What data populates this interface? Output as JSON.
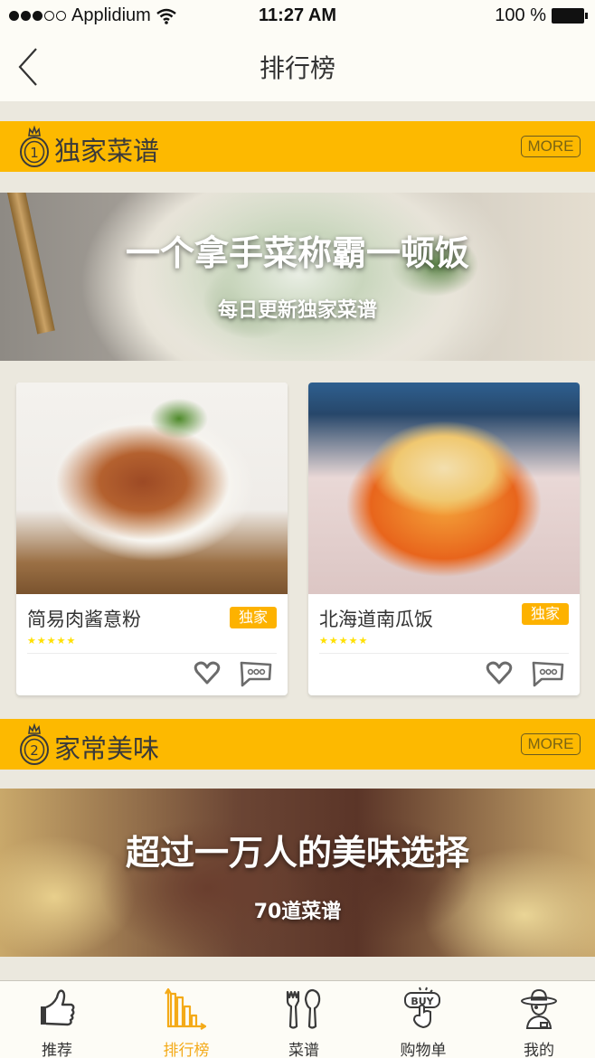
{
  "status_bar": {
    "carrier": "Applidium",
    "signal_bars_filled": 3,
    "signal_bars_total": 5,
    "time": "11:27 AM",
    "battery": "100 %"
  },
  "nav": {
    "title": "排行榜",
    "back_icon": "chevron-left-icon"
  },
  "sections": [
    {
      "rank": "1",
      "title": "独家菜谱",
      "more_label": "MORE",
      "banner": {
        "headline": "一个拿手菜称霸一顿饭",
        "subline": "每日更新独家菜谱"
      },
      "cards": [
        {
          "name": "简易肉酱意粉",
          "badge": "独家",
          "rating": 5,
          "rating_max": 5
        },
        {
          "name": "北海道南瓜饭",
          "badge": "独家",
          "rating": 5,
          "rating_max": 5
        }
      ]
    },
    {
      "rank": "2",
      "title": "家常美味",
      "more_label": "MORE",
      "banner": {
        "headline": "超过一万人的美味选择",
        "subline": "70道菜谱"
      }
    }
  ],
  "tabbar": {
    "active_index": 1,
    "active_color": "#f4aa18",
    "items": [
      {
        "label": "推荐",
        "icon": "thumbs-up-icon"
      },
      {
        "label": "排行榜",
        "icon": "bar-chart-icon"
      },
      {
        "label": "菜谱",
        "icon": "fork-spoon-icon"
      },
      {
        "label": "购物单",
        "icon": "buy-button-icon"
      },
      {
        "label": "我的",
        "icon": "chef-avatar-icon"
      }
    ]
  },
  "colors": {
    "accent": "#fdb900",
    "badge": "#fdb200",
    "star": "#ffe000",
    "background": "#ebe8de"
  }
}
